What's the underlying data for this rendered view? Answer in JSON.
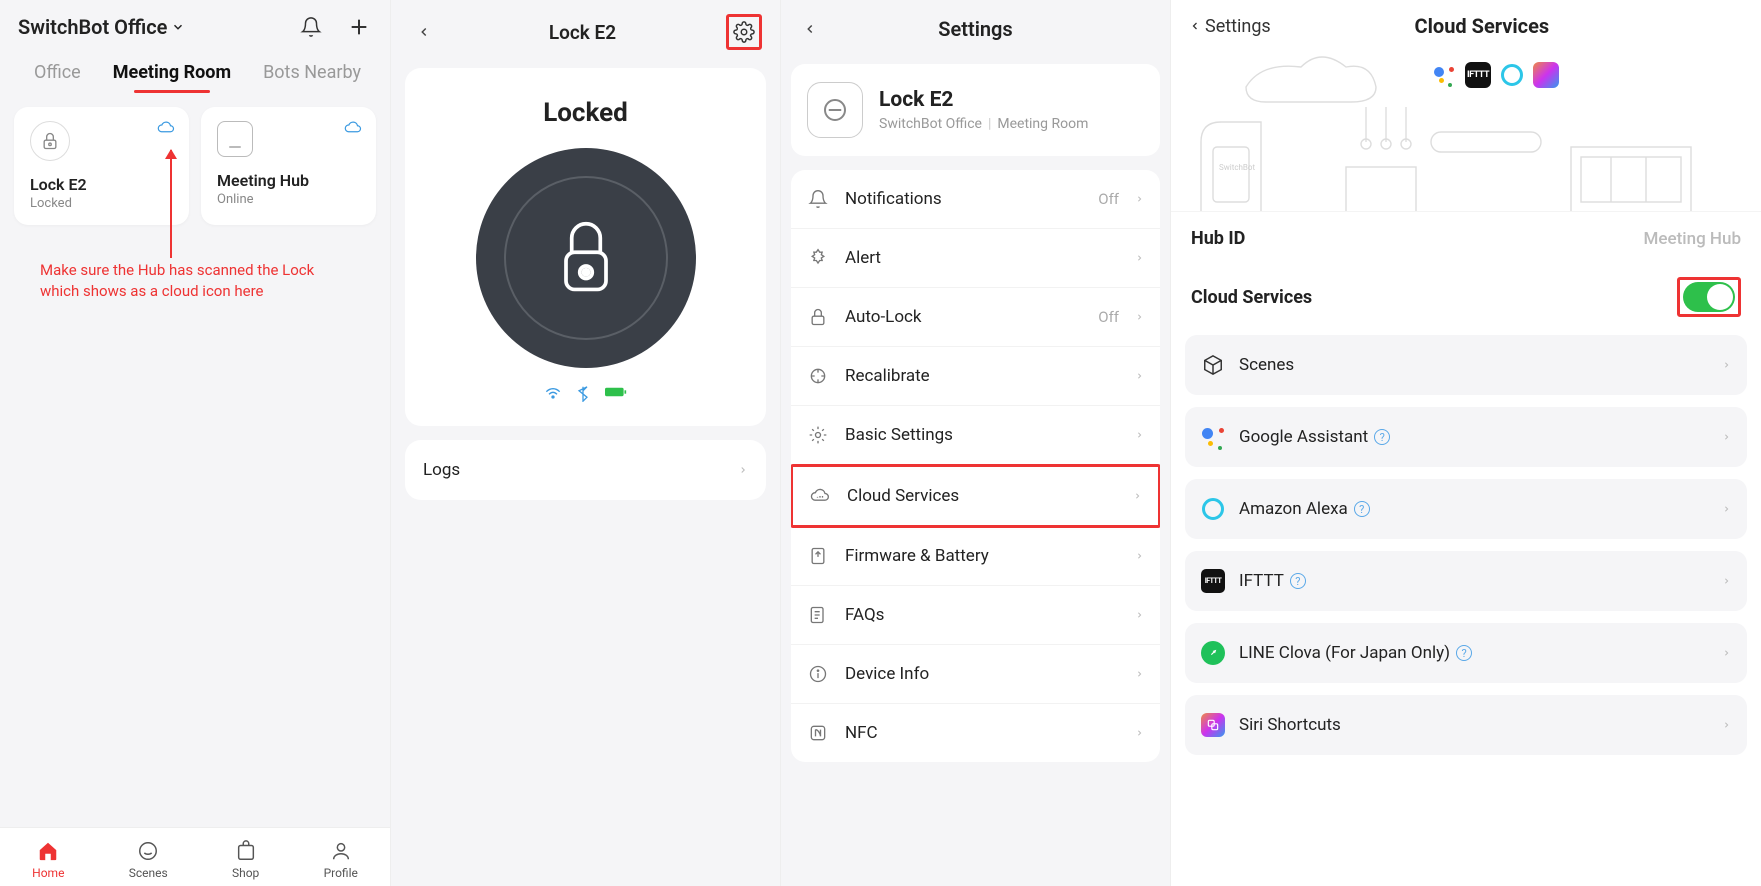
{
  "panel1": {
    "location": "SwitchBot Office",
    "tabs": [
      "Office",
      "Meeting Room",
      "Bots Nearby"
    ],
    "activeTab": 1,
    "devices": [
      {
        "name": "Lock E2",
        "status": "Locked"
      },
      {
        "name": "Meeting Hub",
        "status": "Online"
      }
    ],
    "annotation": "Make sure the Hub has scanned the Lock which shows as a cloud icon here",
    "nav": {
      "home": "Home",
      "scenes": "Scenes",
      "shop": "Shop",
      "profile": "Profile"
    }
  },
  "panel2": {
    "title": "Lock E2",
    "status": "Locked",
    "logs": "Logs"
  },
  "panel3": {
    "title": "Settings",
    "device": {
      "name": "Lock E2",
      "location": "SwitchBot Office",
      "room": "Meeting Room"
    },
    "rows": {
      "notifications": {
        "label": "Notifications",
        "value": "Off"
      },
      "alert": {
        "label": "Alert"
      },
      "autolock": {
        "label": "Auto-Lock",
        "value": "Off"
      },
      "recalibrate": {
        "label": "Recalibrate"
      },
      "basic": {
        "label": "Basic Settings"
      },
      "cloud": {
        "label": "Cloud Services"
      },
      "firmware": {
        "label": "Firmware & Battery"
      },
      "faqs": {
        "label": "FAQs"
      },
      "devinfo": {
        "label": "Device Info"
      },
      "nfc": {
        "label": "NFC"
      }
    }
  },
  "panel4": {
    "back": "Settings",
    "title": "Cloud Services",
    "hubIdLabel": "Hub ID",
    "hubIdValue": "Meeting Hub",
    "cloudLabel": "Cloud Services",
    "services": {
      "scenes": "Scenes",
      "google": "Google Assistant",
      "alexa": "Amazon Alexa",
      "ifttt": "IFTTT",
      "line": "LINE Clova (For Japan Only)",
      "siri": "Siri Shortcuts"
    }
  }
}
